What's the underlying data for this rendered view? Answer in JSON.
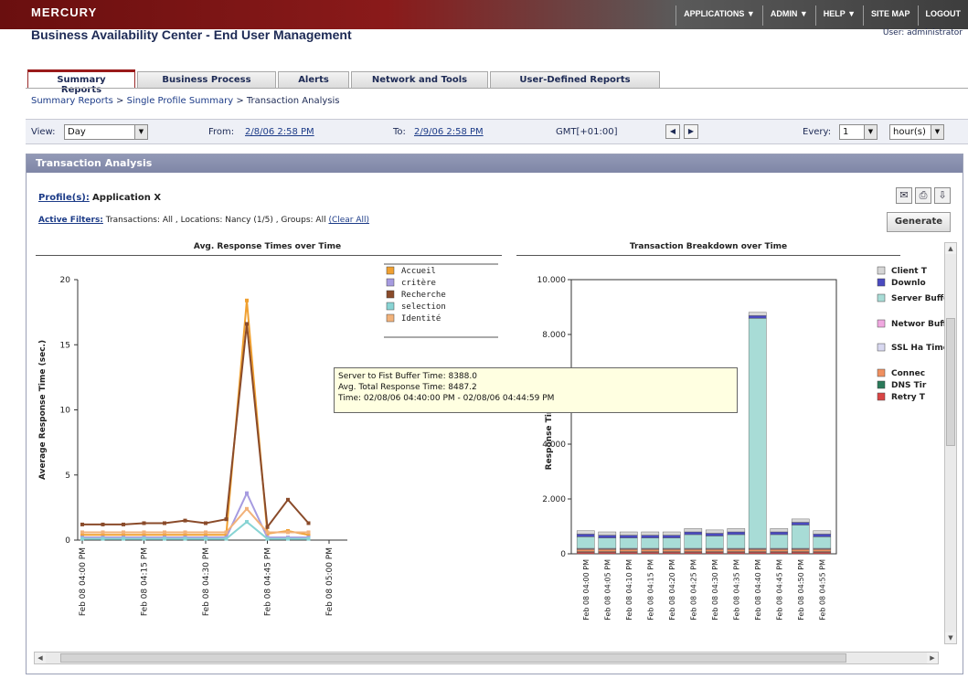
{
  "brand": "MERCURY",
  "app_title": "Business Availability Center - End User Management",
  "user_label": "User: administrator",
  "top_nav": [
    "APPLICATIONS ▼",
    "ADMIN ▼",
    "HELP ▼",
    "SITE MAP",
    "LOGOUT"
  ],
  "tabs": [
    {
      "label": "Summary Reports",
      "active": true
    },
    {
      "label": "Business Process",
      "active": false
    },
    {
      "label": "Alerts",
      "active": false
    },
    {
      "label": "Network and Tools",
      "active": false
    },
    {
      "label": "User-Defined Reports",
      "active": false
    }
  ],
  "breadcrumb": {
    "part1": "Summary Reports",
    "sep1": " > ",
    "part2": "Single Profile Summary",
    "sep2": " > ",
    "current": "Transaction Analysis"
  },
  "toolbar": {
    "view_label": "View:",
    "view_value": "Day",
    "from_label": "From:",
    "from_value": "2/8/06 2:58 PM",
    "to_label": "To:",
    "to_value": "2/9/06 2:58 PM",
    "tz": "GMT[+01:00]",
    "every_label": "Every:",
    "every_value": "1",
    "every_unit": "hour(s)"
  },
  "panel": {
    "title": "Transaction Analysis",
    "profile_label": "Profile(s):",
    "profile_value": "Application X",
    "filters_label": "Active Filters:",
    "filters_value": "Transactions: All , Locations: Nancy (1/5) , Groups: All",
    "clear_all": "(Clear All)",
    "generate_button": "Generate",
    "colors": {
      "header": "#878ead",
      "accent": "#9a1a1a",
      "link": "#1d3c88"
    }
  },
  "tooltip": {
    "line1": "Server to Fist Buffer Time: 8388.0",
    "line2": "Avg. Total Response Time: 8487.2",
    "line3": "Time: 02/08/06 04:40:00 PM - 02/08/06 04:44:59 PM"
  },
  "chart_data": [
    {
      "type": "line",
      "title": "Avg. Response Times over Time",
      "ylabel": "Average Response Time (sec.)",
      "ylim": [
        0,
        20
      ],
      "yticks": [
        0,
        5,
        10,
        15,
        20
      ],
      "x": [
        "4:00",
        "4:05",
        "4:10",
        "4:15",
        "4:20",
        "4:25",
        "4:30",
        "4:35",
        "4:40",
        "4:45",
        "4:50",
        "4:55"
      ],
      "xtick_labels": [
        "Feb 08 04:00 PM",
        "Feb 08 04:15 PM",
        "Feb 08 04:30 PM",
        "Feb 08 04:45 PM",
        "Feb 08 05:00 PM"
      ],
      "grid": false,
      "legend_position": "top-right",
      "series": [
        {
          "name": "Accueil",
          "color": "#f0a030",
          "values": [
            0.4,
            0.4,
            0.4,
            0.4,
            0.4,
            0.4,
            0.4,
            0.4,
            18.4,
            0.5,
            0.7,
            0.4
          ]
        },
        {
          "name": "critère",
          "color": "#a69be0",
          "values": [
            0.2,
            0.2,
            0.2,
            0.2,
            0.2,
            0.2,
            0.2,
            0.2,
            3.6,
            0.2,
            0.2,
            0.2
          ]
        },
        {
          "name": "Recherche",
          "color": "#8a4b2a",
          "values": [
            1.2,
            1.2,
            1.2,
            1.3,
            1.3,
            1.5,
            1.3,
            1.6,
            16.6,
            1.0,
            3.1,
            1.3
          ]
        },
        {
          "name": "selection",
          "color": "#88d4d4",
          "values": [
            0.1,
            0.1,
            0.1,
            0.1,
            0.1,
            0.1,
            0.1,
            0.1,
            1.4,
            0.1,
            0.1,
            0.1
          ]
        },
        {
          "name": "Identité",
          "color": "#f2b27a",
          "values": [
            0.6,
            0.6,
            0.6,
            0.6,
            0.6,
            0.6,
            0.6,
            0.6,
            2.4,
            0.6,
            0.6,
            0.6
          ]
        }
      ]
    },
    {
      "type": "bar",
      "stacked": true,
      "title": "Transaction Breakdown over Time",
      "ylabel": "Response Time",
      "ylim": [
        0,
        10000
      ],
      "yticks": [
        0,
        2000,
        4000,
        8000,
        10000
      ],
      "ytick_labels": [
        "0",
        "2.000",
        "4.000",
        "8.000",
        "10.000"
      ],
      "categories": [
        "Feb 08 04:00 PM",
        "Feb 08 04:05 PM",
        "Feb 08 04:10 PM",
        "Feb 08 04:15 PM",
        "Feb 08 04:20 PM",
        "Feb 08 04:25 PM",
        "Feb 08 04:30 PM",
        "Feb 08 04:35 PM",
        "Feb 08 04:40 PM",
        "Feb 08 04:45 PM",
        "Feb 08 04:50 PM",
        "Feb 08 04:55 PM"
      ],
      "legend_position": "right",
      "series": [
        {
          "name": "Retry T",
          "color": "#d94545",
          "values": [
            60,
            60,
            60,
            60,
            60,
            60,
            60,
            60,
            60,
            60,
            60,
            60
          ]
        },
        {
          "name": "DNS Tir",
          "color": "#2a7a5a",
          "values": [
            20,
            20,
            20,
            20,
            20,
            20,
            20,
            20,
            20,
            20,
            20,
            20
          ]
        },
        {
          "name": "Connec",
          "color": "#f09060",
          "values": [
            80,
            80,
            80,
            80,
            80,
            80,
            80,
            80,
            80,
            80,
            80,
            80
          ]
        },
        {
          "name": "SSL Ha Time",
          "color": "#d8d8f0",
          "values": [
            20,
            20,
            20,
            20,
            20,
            20,
            20,
            20,
            20,
            20,
            20,
            20
          ]
        },
        {
          "name": "Networ Buffer",
          "color": "#f0a8e0",
          "values": [
            20,
            20,
            20,
            20,
            20,
            20,
            20,
            20,
            20,
            20,
            20,
            20
          ]
        },
        {
          "name": "Server Buffer",
          "color": "#a8dcd6",
          "values": [
            420,
            380,
            380,
            380,
            380,
            500,
            450,
            500,
            8388,
            500,
            850,
            420
          ]
        },
        {
          "name": "Downlo",
          "color": "#4a4ac0",
          "values": [
            100,
            100,
            100,
            100,
            100,
            100,
            100,
            100,
            100,
            100,
            100,
            100
          ]
        },
        {
          "name": "Client T",
          "color": "#d6d6d6",
          "values": [
            120,
            120,
            120,
            120,
            120,
            120,
            120,
            120,
            120,
            120,
            120,
            120
          ]
        }
      ]
    }
  ]
}
